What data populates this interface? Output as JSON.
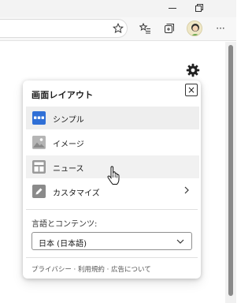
{
  "window": {
    "minimize_icon": "minimize-icon",
    "restore_icon": "restore-icon"
  },
  "toolbar": {
    "favorite_icon": "star-icon",
    "favorites_icon": "favorites-list-icon",
    "collections_icon": "collections-icon",
    "more_label": "···"
  },
  "page": {
    "settings_icon": "gear-icon"
  },
  "panel": {
    "title": "画面レイアウト",
    "close_label": "×",
    "options": [
      {
        "label": "シンプル",
        "icon": "simple-layout-icon",
        "state": "selected"
      },
      {
        "label": "イメージ",
        "icon": "image-layout-icon",
        "state": "normal"
      },
      {
        "label": "ニュース",
        "icon": "news-layout-icon",
        "state": "hover"
      },
      {
        "label": "カスタマイズ",
        "icon": "pencil-icon",
        "state": "normal"
      }
    ],
    "language_label": "言語とコンテンツ:",
    "language_value": "日本 (日本語)",
    "footer": "プライバシー · 利用規約 · 広告について"
  },
  "colors": {
    "accent": "#2f6fd6",
    "icon_gray": "#8a8a8a"
  }
}
